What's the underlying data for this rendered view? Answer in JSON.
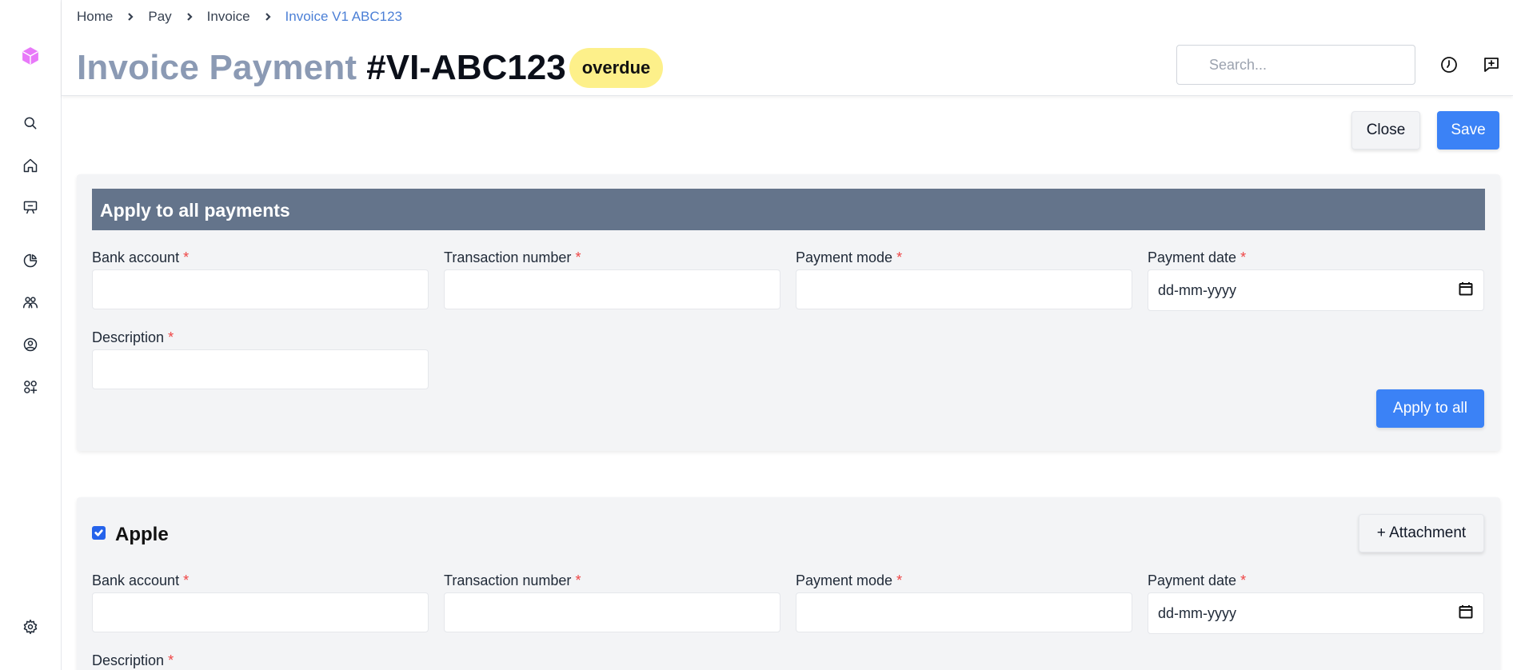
{
  "breadcrumb": {
    "items": [
      "Home",
      "Pay",
      "Invoice"
    ],
    "current": "Invoice V1 ABC123"
  },
  "page": {
    "title": "Invoice Payment",
    "invoice_id": "#VI-ABC123",
    "status": "overdue"
  },
  "search": {
    "placeholder": "Search..."
  },
  "actions": {
    "close": "Close",
    "save": "Save"
  },
  "apply_all": {
    "heading": "Apply to all payments",
    "fields": {
      "bank_account": "Bank account",
      "transaction_number": "Transaction number",
      "payment_mode": "Payment mode",
      "payment_date": "Payment date",
      "description": "Description"
    },
    "required_mark": "*",
    "date_placeholder": "dd-mm-yyyy",
    "button": "Apply to all"
  },
  "payments": [
    {
      "company": "Apple",
      "checked": true,
      "attachment_button": "+ Attachment",
      "fields": {
        "bank_account": "Bank account",
        "transaction_number": "Transaction number",
        "payment_mode": "Payment mode",
        "payment_date": "Payment date",
        "description": "Description"
      },
      "date_placeholder": "dd-mm-yyyy"
    }
  ],
  "colors": {
    "primary": "#3b82f6",
    "badge": "#fdf08a",
    "section_bar": "#64748b",
    "required": "#ef4444",
    "breadcrumb_current": "#4b7fd6"
  },
  "sidebar": {
    "icons": [
      "app-logo-icon",
      "search-icon",
      "home-icon",
      "presentation-icon",
      "pie-chart-icon",
      "users-icon",
      "user-circle-icon",
      "apps-add-icon",
      "settings-icon"
    ]
  }
}
